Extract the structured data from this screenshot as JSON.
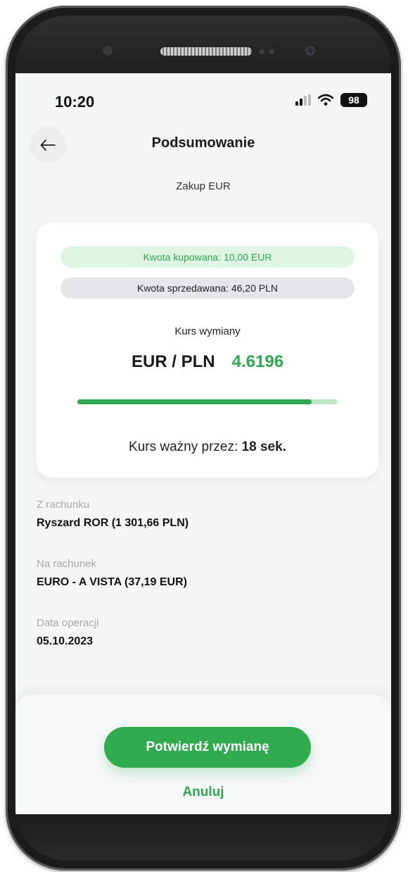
{
  "status_bar": {
    "time": "10:20",
    "battery": "98",
    "icons": [
      "signal-icon",
      "wifi-icon",
      "battery-icon"
    ]
  },
  "header": {
    "title": "Podsumowanie",
    "back_icon": "arrow-left-icon",
    "subtitle": "Zakup EUR"
  },
  "card": {
    "buy_amount": "Kwota kupowana: 10,00 EUR",
    "sell_amount": "Kwota sprzedawana: 46,20 PLN",
    "rate_label": "Kurs wymiany",
    "pair": "EUR / PLN",
    "rate": "4.6196",
    "validity_prefix": "Kurs ważny przez:",
    "validity_value": "18 sek.",
    "timer_remaining_fraction": 0.9
  },
  "details": [
    {
      "label": "Z rachunku",
      "value": "Ryszard ROR (1 301,66 PLN)"
    },
    {
      "label": "Na rachunek",
      "value": "EURO - A VISTA (37,19 EUR)"
    },
    {
      "label": "Data operacji",
      "value": "05.10.2023"
    }
  ],
  "actions": {
    "confirm": "Potwierdź wymianę",
    "cancel": "Anuluj"
  },
  "colors": {
    "accent": "#2faa4f",
    "accent_light": "#dff4e4",
    "background": "#f4f5f5"
  }
}
